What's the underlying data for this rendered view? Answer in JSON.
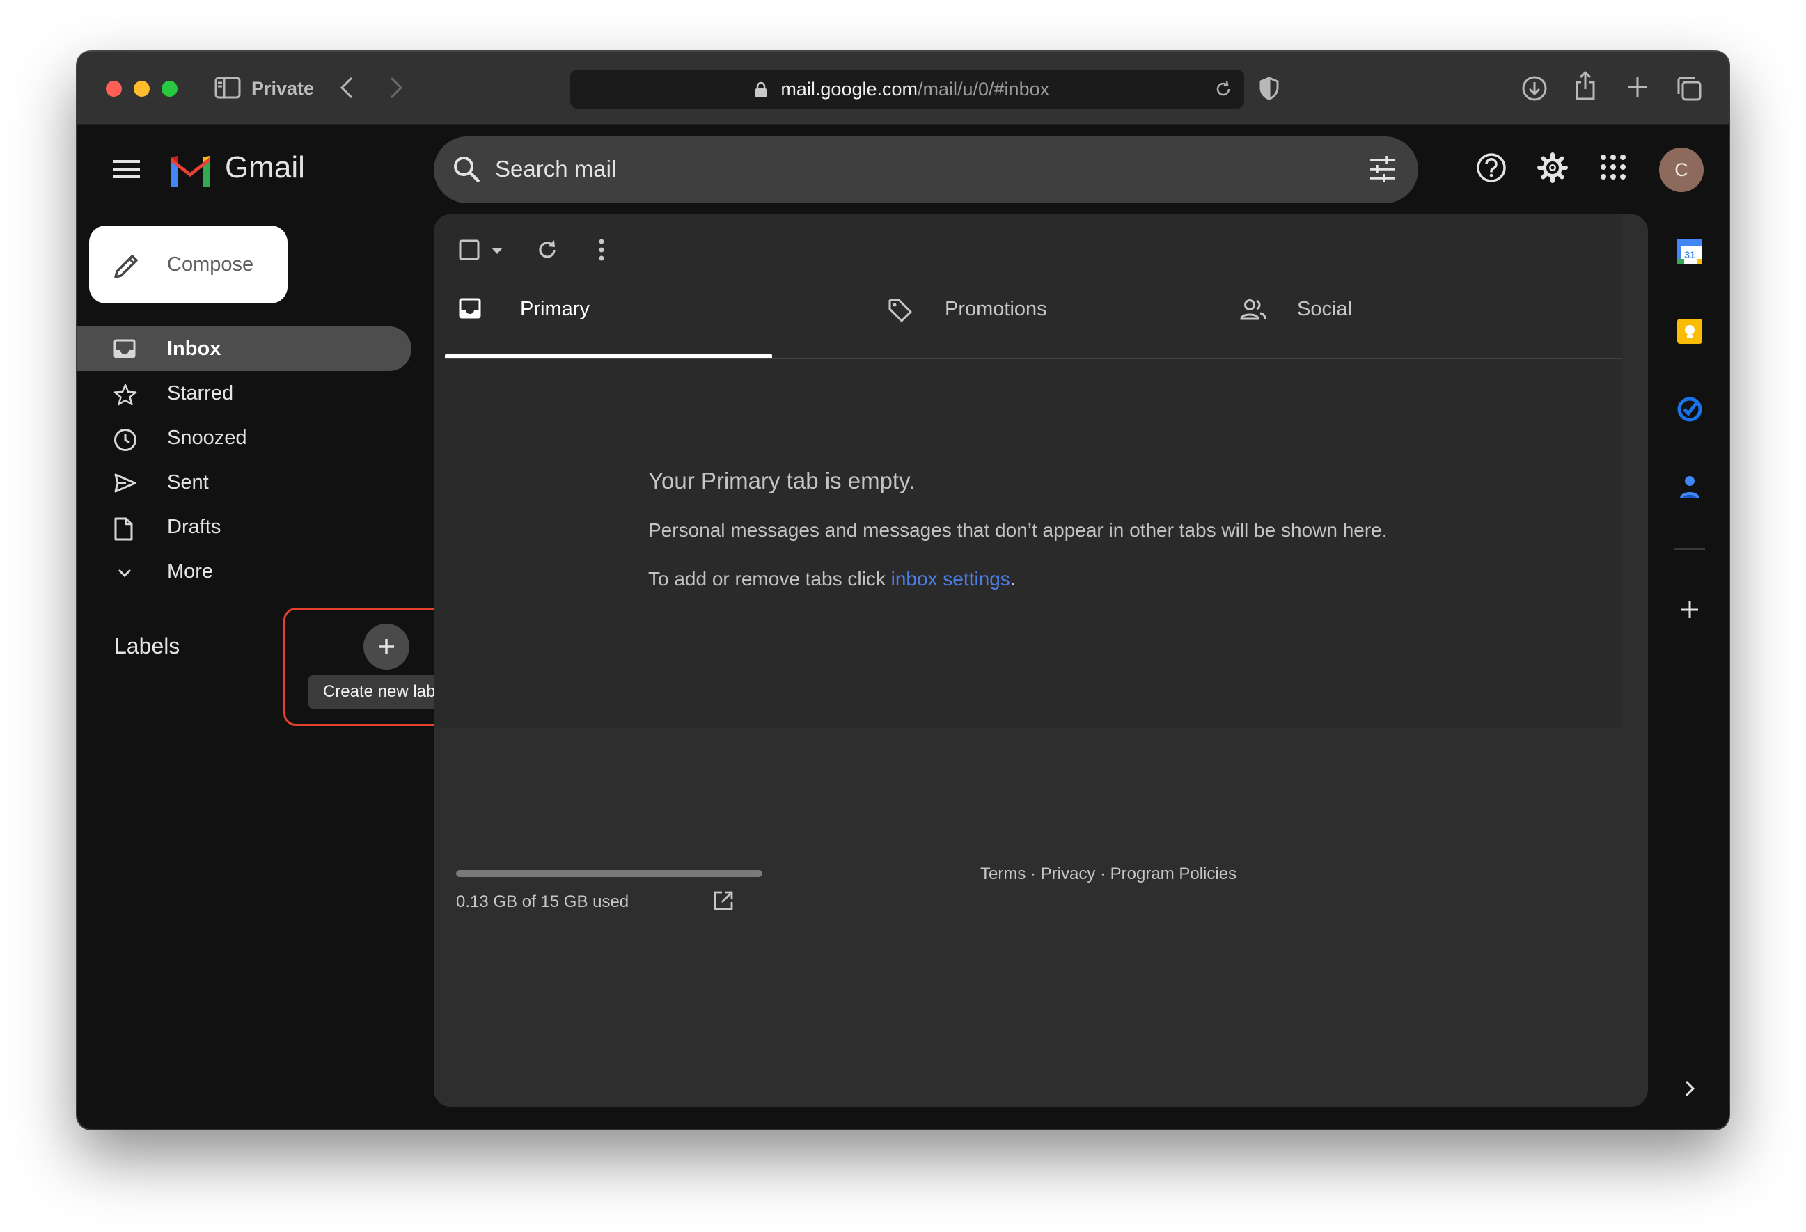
{
  "browser": {
    "mode_label": "Private",
    "url_host": "mail.google.com",
    "url_path": "/mail/u/0/#inbox"
  },
  "gmail": {
    "wordmark": "Gmail",
    "search_placeholder": "Search mail",
    "avatar_initial": "C"
  },
  "sidebar": {
    "compose_label": "Compose",
    "items": [
      {
        "label": "Inbox",
        "icon": "inbox-icon",
        "active": true
      },
      {
        "label": "Starred",
        "icon": "star-icon"
      },
      {
        "label": "Snoozed",
        "icon": "clock-icon"
      },
      {
        "label": "Sent",
        "icon": "send-icon"
      },
      {
        "label": "Drafts",
        "icon": "draft-icon"
      },
      {
        "label": "More",
        "icon": "chevron-down-icon"
      }
    ],
    "labels_heading": "Labels",
    "create_label_tooltip": "Create new label"
  },
  "tabs": [
    {
      "label": "Primary",
      "icon": "inbox-icon",
      "active": true
    },
    {
      "label": "Promotions",
      "icon": "tag-icon"
    },
    {
      "label": "Social",
      "icon": "people-icon"
    }
  ],
  "empty_state": {
    "title": "Your Primary tab is empty.",
    "description": "Personal messages and messages that don’t appear in other tabs will be shown here.",
    "settings_prefix": "To add or remove tabs click ",
    "settings_link": "inbox settings",
    "settings_suffix": "."
  },
  "footer": {
    "storage_text": "0.13 GB of 15 GB used",
    "storage_used_fraction": 0.009,
    "links": "Terms · Privacy · Program Policies"
  },
  "colors": {
    "highlight": "#e2412d",
    "link": "#4d7fe8",
    "background": "#111111"
  }
}
